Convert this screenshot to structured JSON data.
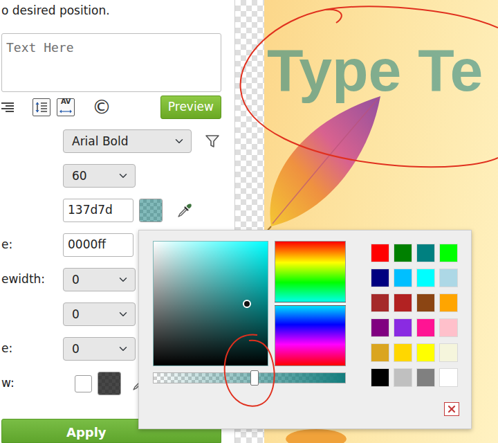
{
  "hint": "o desired position.",
  "text_box": {
    "placeholder": "Text Here"
  },
  "toolbar": {
    "kerning": "AV",
    "copyright": "©",
    "preview": "Preview"
  },
  "fields": [
    {
      "kind": "font",
      "value": "Arial Bold"
    },
    {
      "kind": "select",
      "value": "60"
    },
    {
      "kind": "color",
      "value": "137d7d"
    },
    {
      "kind": "text",
      "label": "e:",
      "value": "0000ff"
    },
    {
      "kind": "select",
      "label": "ewidth:",
      "value": "0"
    },
    {
      "kind": "select",
      "value": "0"
    },
    {
      "kind": "select",
      "label": "e:",
      "value": "0"
    },
    {
      "kind": "shadow",
      "label": "w:",
      "checked": false
    }
  ],
  "apply": "Apply",
  "canvas": {
    "text": "Type Te"
  },
  "color_picker": {
    "hue": 0.5,
    "saturation": 0.82,
    "brightness": 0.5,
    "alpha": 0.53,
    "swatches": [
      {
        "color": "#ff0000"
      },
      {
        "color": "#008000"
      },
      {
        "color": "#008080"
      },
      {
        "color": "#00ff00"
      },
      {
        "color": "#000080"
      },
      {
        "color": "#00bfff"
      },
      {
        "color": "#00ffff"
      },
      {
        "color": "#add8e6"
      },
      {
        "color": "#a52a2a"
      },
      {
        "color": "#b22222"
      },
      {
        "color": "#8b4513"
      },
      {
        "color": "#ffa500"
      },
      {
        "color": "#800080"
      },
      {
        "color": "#8a2be2"
      },
      {
        "color": "#ff1493"
      },
      {
        "color": "#ffc0cb"
      },
      {
        "color": "#daa520"
      },
      {
        "color": "#ffd700"
      },
      {
        "color": "#ffff00"
      },
      {
        "color": "#f5f5dc"
      },
      {
        "color": "#000000"
      },
      {
        "color": "#c0c0c0"
      },
      {
        "color": "#808080"
      },
      {
        "color": "#ffffff"
      }
    ]
  }
}
